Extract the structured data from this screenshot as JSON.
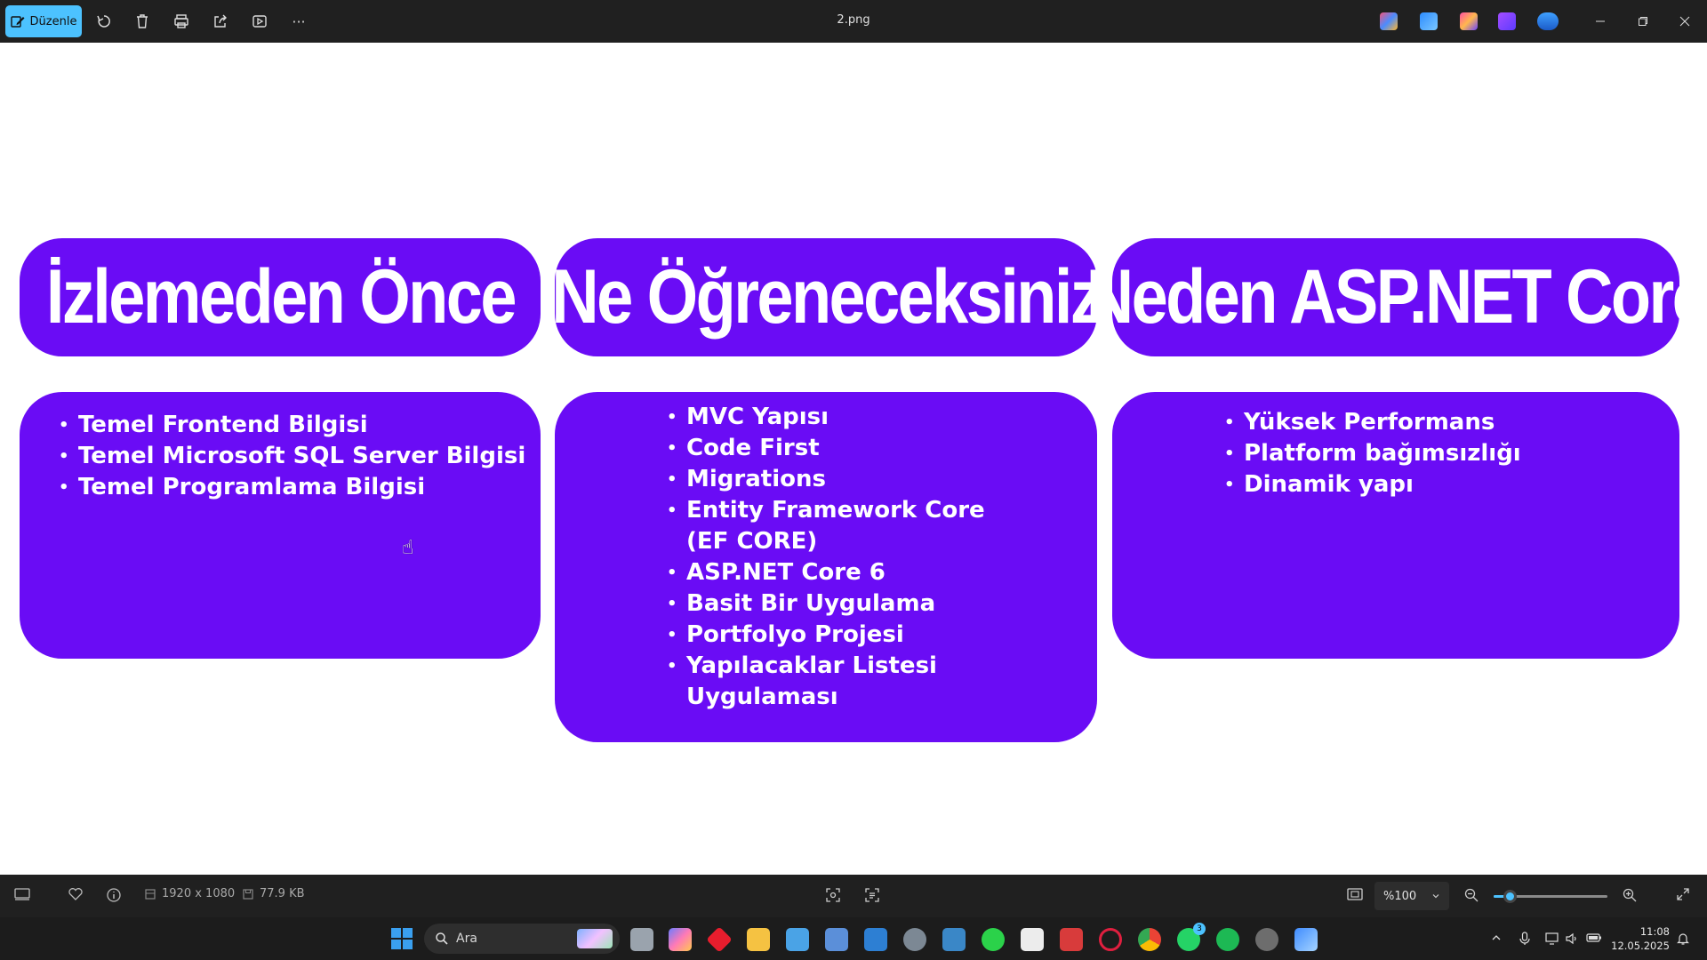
{
  "titlebar": {
    "edit_label": "Düzenle",
    "filename": "2.png",
    "toolbar_icons": [
      "rotate-icon",
      "delete-icon",
      "print-icon",
      "share-icon",
      "slideshow-icon",
      "more-icon"
    ],
    "more_glyph": "···"
  },
  "slide": {
    "headers": [
      "İzlemeden Önce",
      "Ne Öğreneceksiniz",
      "Neden ASP.NET Core"
    ],
    "list1": [
      "Temel Frontend Bilgisi",
      "Temel Microsoft SQL Server Bilgisi",
      "Temel Programlama Bilgisi"
    ],
    "list2": [
      "MVC Yapısı",
      "Code First",
      "Migrations",
      "Entity Framework Core",
      "(EF CORE)",
      "ASP.NET Core 6",
      "Basit Bir Uygulama",
      "Portfolyo Projesi",
      "Yapılacaklar Listesi",
      "Uygulaması"
    ],
    "list3": [
      "Yüksek Performans",
      "Platform bağımsızlığı",
      "Dinamik yapı"
    ],
    "card_color": "#6a0cf5"
  },
  "bottombar": {
    "dimensions": "1920 x 1080",
    "filesize": "77.9 KB",
    "zoom": "%100",
    "zoom_slider_fraction": 0.14
  },
  "taskbar": {
    "search_placeholder": "Ara",
    "time": "11:08",
    "date": "12.05.2025",
    "whatsapp_badge": "3"
  }
}
